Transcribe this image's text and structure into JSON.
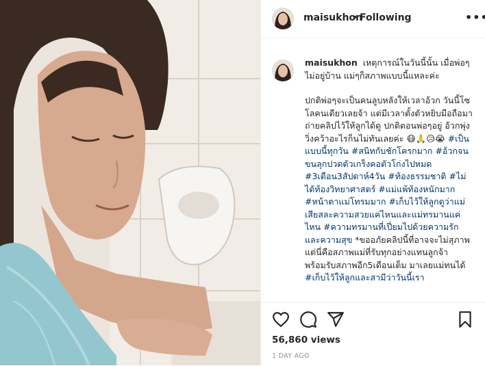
{
  "post": {
    "username": "maisukhon",
    "dot": "•",
    "follow_status": "Following",
    "more_icon": "more-options-icon",
    "more_label": "•••",
    "caption": {
      "username": "maisukhon",
      "line1": "เหตุการณ์ในวันนี้นั้น เมื่อพ่อๆ ไม่อยู่บ้าน แม่ๆก็สภาพแบบนี้แหละค่ะ",
      "body_text": "ปกติพ่อๆจะเป็นคนลูบหลังให้เวลาอ้วก วันนี้โซโลคนเดียวเลยจ้า แต่มีเวลาตั้งตัวหยิบมือถือมาถ่ายคลิปไว้ให้ลูกได้ดู ปกติตอนพ่อๆอยู่ อ้วกพุ่งวิ่งคว้าอะไรก็นไม่ทันเลยค่ะ 😷🙏😥😭",
      "tags": [
        "#เป็นแบบนี้ทุกวัน",
        "#สนิทกับชักโครกมาก",
        "#อ้วกจนขนลุกปวดตัวเกร็งคอตัวโก่งไปหมด",
        "#3เดือน3สัปดาห์4วัน",
        "#ท้องธรรมชาติ",
        "#ไม่ได้ท้องวิทยาศาสตร์",
        "#แม่แพ้ท้องหนักมาก",
        "#หน้าตาแม่โทรมมาก",
        "#เก็บไว้ให้ลูกดูว่าแม่เสียสละความสวยแค่ไหนและแม่ทรมานแค่ไหน",
        "#ความทรมานที่เปี่ยมไปด้วยความรักและความสุข"
      ],
      "after_tags": "*ขออภัยคลิปนี้ที่อาจจะไม่สุภาพ แต่นี่คือสภาพแม่ที่รับทุกอย่างแทนลูกจ้า",
      "line_last": "พร้อมรับสภาพอีก5เดือนเต็ม มาเลยแม่ทนได้",
      "tag_last": "#เก็บไว้ให้ลูกและสามีว่าวันนี้เรา"
    },
    "actions": {
      "like_icon": "heart-icon",
      "comment_icon": "comment-icon",
      "share_icon": "share-icon",
      "save_icon": "bookmark-icon"
    },
    "views": "56,860 views",
    "time_ago": "1 DAY AGO"
  },
  "colors": {
    "text": "#262626",
    "hashtag": "#00376b",
    "muted": "#8e8e8e",
    "divider": "#efefef"
  }
}
